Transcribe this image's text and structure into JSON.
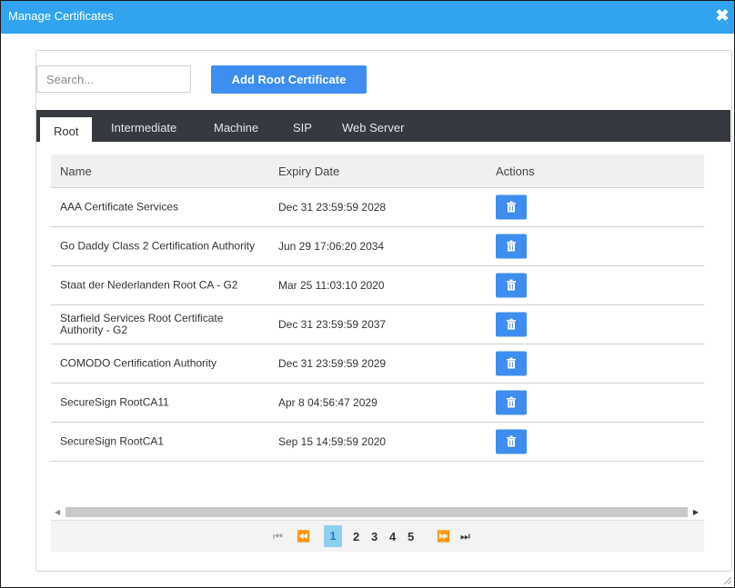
{
  "window": {
    "title": "Manage Certificates",
    "close_glyph": "✖"
  },
  "toolbar": {
    "search_placeholder": "Search...",
    "add_label": "Add Root Certificate"
  },
  "tabs": [
    {
      "label": "Root",
      "active": true
    },
    {
      "label": "Intermediate",
      "active": false
    },
    {
      "label": "Machine",
      "active": false
    },
    {
      "label": "SIP",
      "active": false
    },
    {
      "label": "Web Server",
      "active": false
    }
  ],
  "table": {
    "headers": {
      "name": "Name",
      "expiry": "Expiry Date",
      "actions": "Actions"
    },
    "rows": [
      {
        "name": "AAA Certificate Services",
        "expiry": "Dec 31 23:59:59 2028"
      },
      {
        "name": "Go Daddy Class 2 Certification Authority",
        "expiry": "Jun 29 17:06:20 2034"
      },
      {
        "name": "Staat der Nederlanden Root CA - G2",
        "expiry": "Mar 25 11:03:10 2020"
      },
      {
        "name": "Starfield Services Root Certificate Authority - G2",
        "expiry": "Dec 31 23:59:59 2037"
      },
      {
        "name": "COMODO Certification Authority",
        "expiry": "Dec 31 23:59:59 2029"
      },
      {
        "name": "SecureSign RootCA11",
        "expiry": "Apr 8 04:56:47 2029"
      },
      {
        "name": "SecureSign RootCA1",
        "expiry": "Sep 15 14:59:59 2020"
      }
    ]
  },
  "pagination": {
    "first": "⏮",
    "prev": "⏪",
    "pages": [
      "1",
      "2",
      "3",
      "4",
      "5"
    ],
    "current": "1",
    "next": "⏩",
    "last": "⏭"
  },
  "icons": {
    "delete": "trash-icon",
    "close": "close-icon"
  },
  "colors": {
    "titlebar": "#32a3ee",
    "primary_button": "#3d8ef0",
    "tabbar": "#363a40",
    "page_current_bg": "#8fd0ef"
  }
}
